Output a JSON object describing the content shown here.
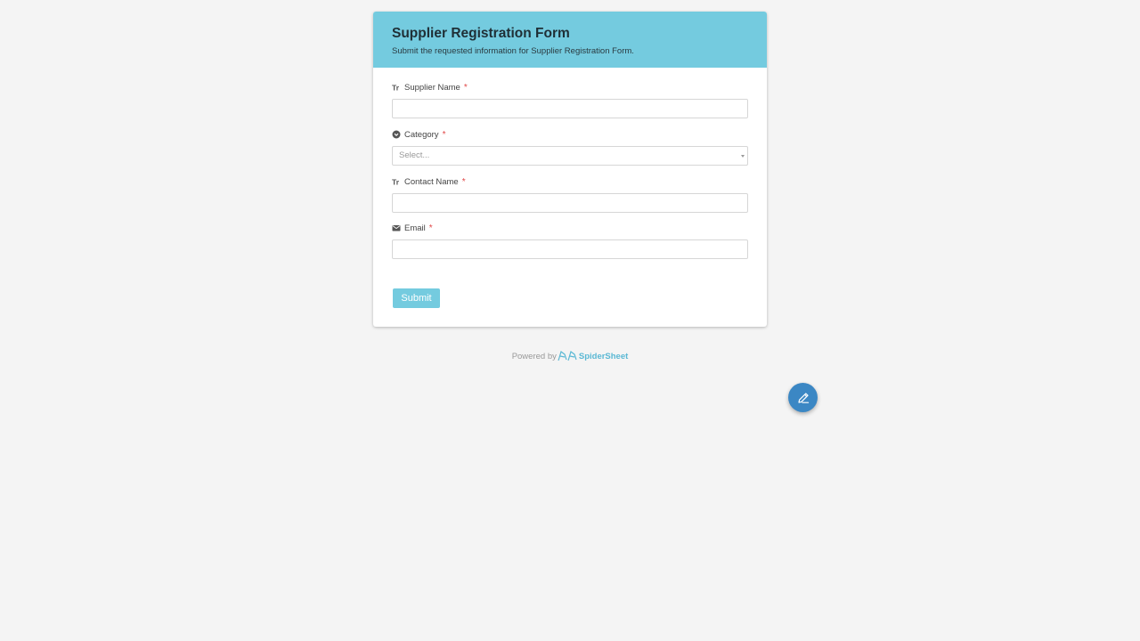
{
  "form": {
    "title": "Supplier Registration Form",
    "subtitle": "Submit the requested information for Supplier Registration Form.",
    "header_color": "#74cbdf",
    "fields": [
      {
        "label": "Supplier Name",
        "icon": "text-type-icon",
        "required": "*",
        "value": ""
      },
      {
        "label": "Category",
        "icon": "select-circle-icon",
        "required": "*",
        "placeholder": "Select..."
      },
      {
        "label": "Contact Name",
        "icon": "text-type-icon",
        "required": "*",
        "value": ""
      },
      {
        "label": "Email",
        "icon": "envelope-icon",
        "required": "*",
        "value": ""
      }
    ],
    "submit_label": "Submit"
  },
  "footer": {
    "powered_by": "Powered by",
    "brand": "SpiderSheet",
    "brand_color": "#5ab8d4"
  },
  "fab": {
    "icon": "pencil-icon",
    "color": "#3b87c4"
  }
}
